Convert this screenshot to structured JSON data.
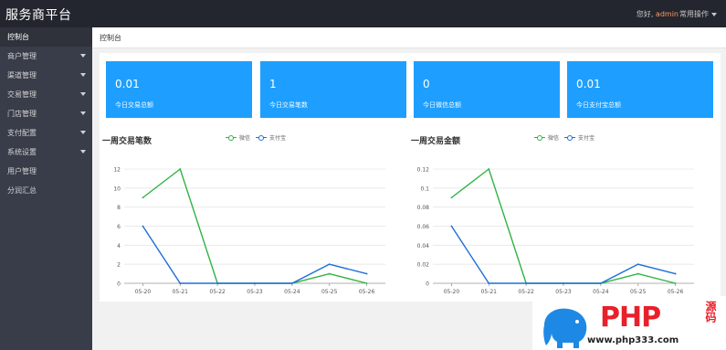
{
  "app": {
    "title": "服务商平台",
    "greeting": "您好,",
    "user": "admin",
    "ops_label": "常用操作"
  },
  "sidebar": {
    "items": [
      {
        "label": "控制台",
        "arrow": false,
        "active": true
      },
      {
        "label": "商户管理",
        "arrow": true
      },
      {
        "label": "渠道管理",
        "arrow": true
      },
      {
        "label": "交易管理",
        "arrow": true
      },
      {
        "label": "门店管理",
        "arrow": true
      },
      {
        "label": "支付配置",
        "arrow": true
      },
      {
        "label": "系统设置",
        "arrow": true
      },
      {
        "label": "用户管理",
        "arrow": false
      },
      {
        "label": "分润汇总",
        "arrow": false
      }
    ]
  },
  "breadcrumb": "控制台",
  "cards": [
    {
      "value": "0.01",
      "label": "今日交易总额"
    },
    {
      "value": "1",
      "label": "今日交易笔数"
    },
    {
      "value": "0",
      "label": "今日微信总额"
    },
    {
      "value": "0.01",
      "label": "今日支付宝总额"
    }
  ],
  "colors": {
    "accent": "#1e9fff",
    "wechat": "#2fb344",
    "alipay": "#1e6fd9"
  },
  "watermark": {
    "text": "PHP",
    "cn": "源码",
    "url": "www.php333.com"
  },
  "chart_data": [
    {
      "type": "line",
      "title": "一周交易笔数",
      "categories": [
        "05-20",
        "05-21",
        "05-22",
        "05-23",
        "05-24",
        "05-25",
        "05-26"
      ],
      "yticks": [
        "0",
        "2",
        "4",
        "6",
        "8",
        "10",
        "12"
      ],
      "ylim": [
        0,
        12
      ],
      "series": [
        {
          "name": "微信",
          "values": [
            9,
            12,
            0,
            0,
            0,
            1,
            0
          ]
        },
        {
          "name": "支付宝",
          "values": [
            6,
            0,
            0,
            0,
            0,
            2,
            1
          ]
        }
      ],
      "legend": "top-center",
      "grid": true
    },
    {
      "type": "line",
      "title": "一周交易金额",
      "categories": [
        "05-20",
        "05-21",
        "05-22",
        "05-23",
        "05-24",
        "05-25",
        "05-26"
      ],
      "yticks": [
        "0",
        "0.02",
        "0.04",
        "0.06",
        "0.08",
        "0.1",
        "0.12"
      ],
      "ylim": [
        0,
        0.12
      ],
      "series": [
        {
          "name": "微信",
          "values": [
            0.09,
            0.12,
            0,
            0,
            0,
            0.01,
            0
          ]
        },
        {
          "name": "支付宝",
          "values": [
            0.06,
            0,
            0,
            0,
            0,
            0.02,
            0.01
          ]
        }
      ],
      "legend": "top-center",
      "grid": true
    }
  ]
}
